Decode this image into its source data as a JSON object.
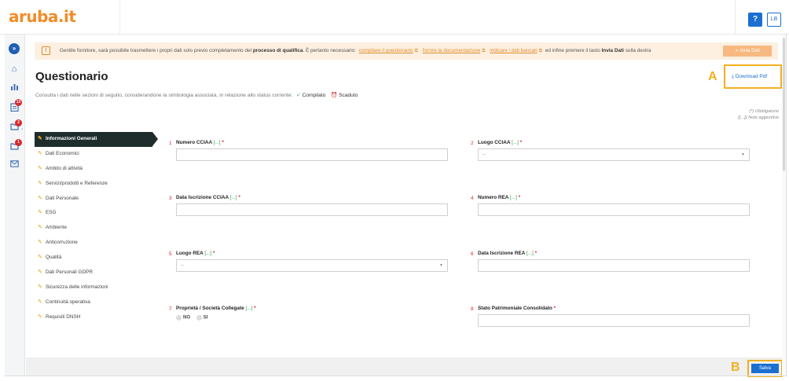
{
  "app": {
    "logo": "aruba.it",
    "help_label": "?",
    "user_initials": "LB"
  },
  "sidebar": {
    "items": [
      {
        "icon": "chevrons-right-icon"
      },
      {
        "icon": "home-icon"
      },
      {
        "icon": "bar-chart-icon"
      },
      {
        "icon": "clipboard-icon",
        "badge": "13"
      },
      {
        "icon": "folder-icon",
        "badge": "2"
      },
      {
        "icon": "folder-icon",
        "badge": "1"
      },
      {
        "icon": "mail-icon"
      }
    ]
  },
  "notice": {
    "text1": "Gentile fornitore, sarà possibile trasmettere i propri dati solo previo completamento del",
    "bold1": "processo di qualifica",
    "text2": ". È pertanto necessario:",
    "link1": "compilare il questionario",
    "link2": "fornire la documentazione",
    "link3": "indicare i dati bancari",
    "text3": "ed infine premere il tasto",
    "bold2": "Invia Dati",
    "text4": "sulla destra",
    "send_button": "Invia Dati"
  },
  "page": {
    "title": "Questionario",
    "subtitle": "Consulta i dati nelle sezioni di seguito, considerandone la simbologia associata, in relazione allo status corrente:",
    "status_done": "Compilato",
    "status_expired": "Scaduto",
    "download_label": "Download Pdf",
    "marker_a": "A",
    "marker_b": "B",
    "legend_required": "(*) Obbligatorio",
    "legend_notes": "([...]) Note aggiuntive"
  },
  "nav": [
    "Informazioni Generali",
    "Dati Economici",
    "Ambito di attività",
    "Servizi/prodotti e Referenze",
    "Dati Personale",
    "ESG",
    "Ambiente",
    "Anticorruzione",
    "Qualità",
    "Dati Personali GDPR",
    "Sicurezza delle informazioni",
    "Continuità operativa",
    "Requisiti DNSH"
  ],
  "fields": [
    {
      "num": "1",
      "label": "Numero CCIAA",
      "note": "[...]",
      "req": "*"
    },
    {
      "num": "2",
      "label": "Luogo CCIAA",
      "note": "[...]",
      "req": "*",
      "select_value": "--"
    },
    {
      "num": "3",
      "label": "Data Iscrizione CCIAA",
      "note": "[...]",
      "req": "*"
    },
    {
      "num": "4",
      "label": "Numero REA",
      "note": "[...]",
      "req": "*"
    },
    {
      "num": "5",
      "label": "Luogo REA",
      "note": "[...]",
      "req": "*",
      "select_value": "--"
    },
    {
      "num": "6",
      "label": "Data Iscrizione REA",
      "note": "[...]",
      "req": "*"
    },
    {
      "num": "7",
      "label": "Proprietà / Società Collegate",
      "note": "[...]",
      "req": "*",
      "opt_no": "NO",
      "opt_si": "SI"
    },
    {
      "num": "8",
      "label": "Stato Patrimoniale Consolidato",
      "req": "*"
    }
  ],
  "footer": {
    "save_label": "Salva"
  },
  "colors": {
    "accent": "#1a6fd1",
    "brand": "#f28c28",
    "highlight": "#f2b01e",
    "required": "#d9262c",
    "note": "#2e9e4a"
  }
}
